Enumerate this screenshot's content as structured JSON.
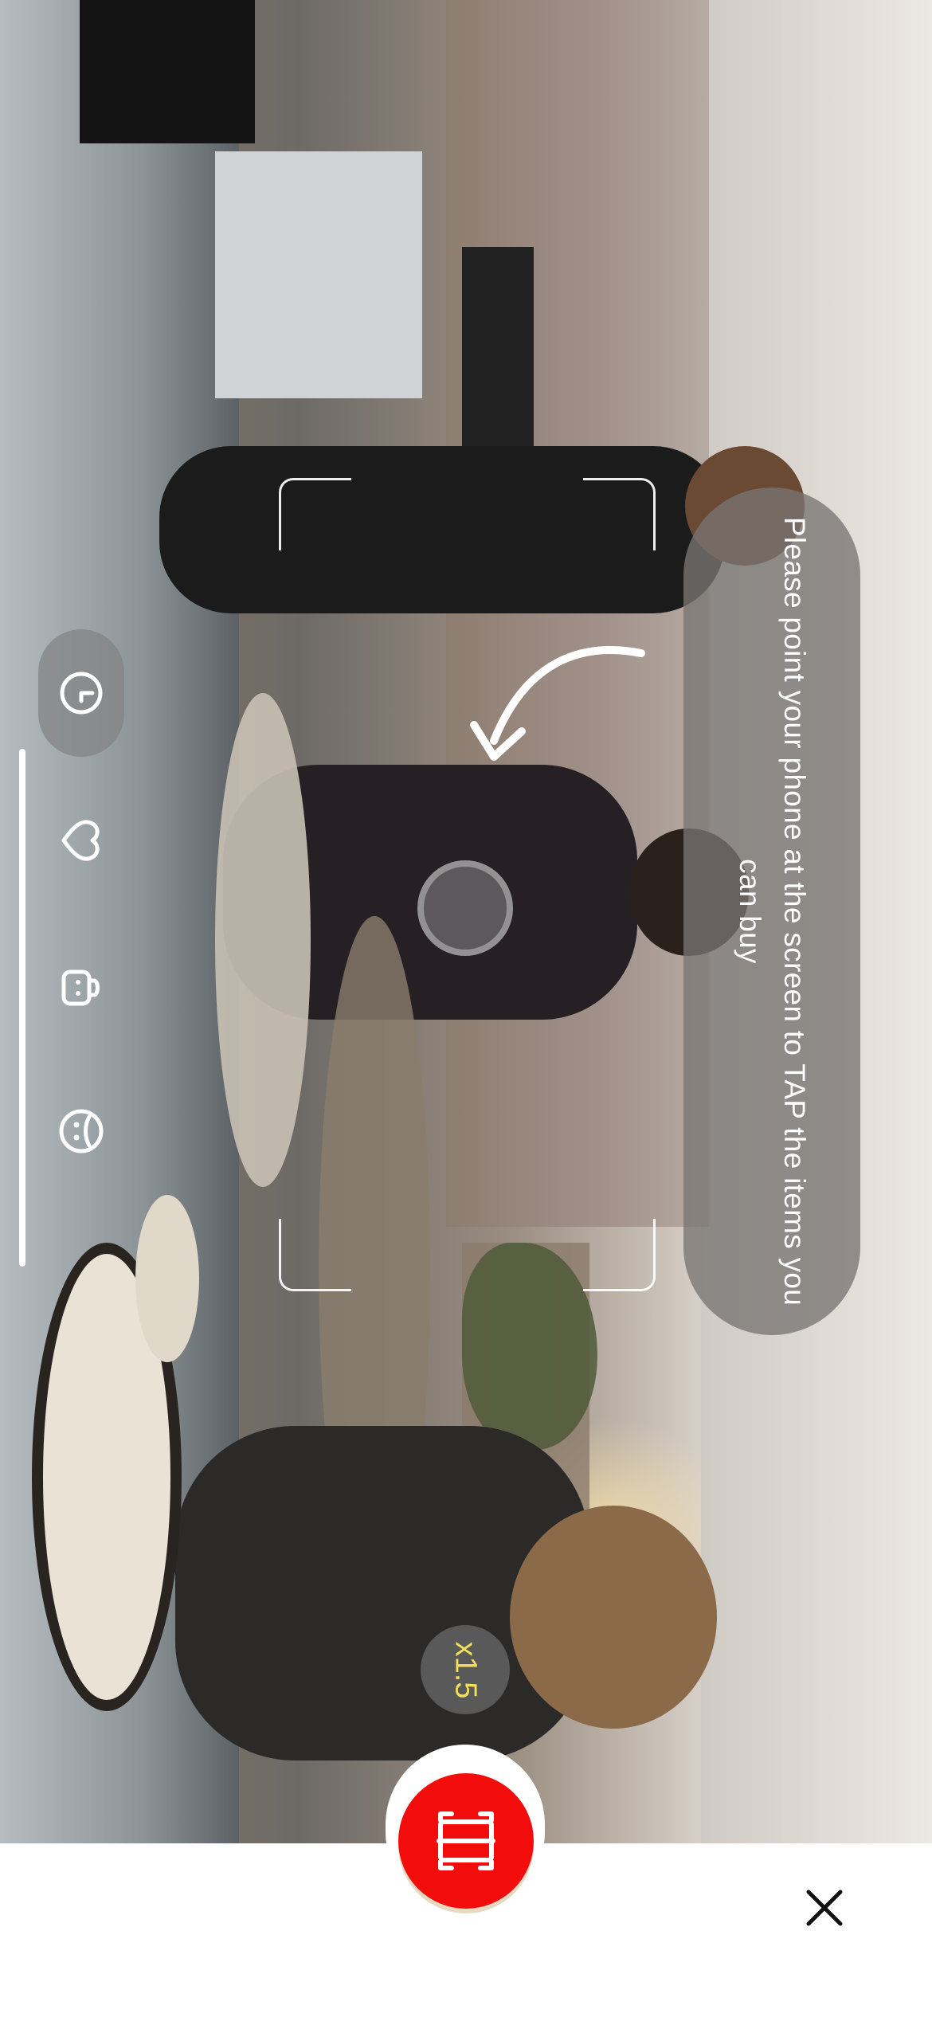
{
  "hint": {
    "text": "Please point your phone at the screen to TAP the items you can buy"
  },
  "toolbar": {
    "items": [
      {
        "icon": "history-icon",
        "label": ""
      },
      {
        "icon": "heart-icon",
        "label": ""
      },
      {
        "icon": "shopping-bag-icon",
        "label": ""
      },
      {
        "icon": "face-icon",
        "label": ""
      }
    ]
  },
  "zoom": {
    "label": "x1.5"
  },
  "colors": {
    "accent": "#f20c0c",
    "zoom_text": "#f4e05a",
    "hint_bubble": "#7a7472"
  },
  "icons": {
    "shutter": "scan-icon",
    "close": "close-icon"
  }
}
